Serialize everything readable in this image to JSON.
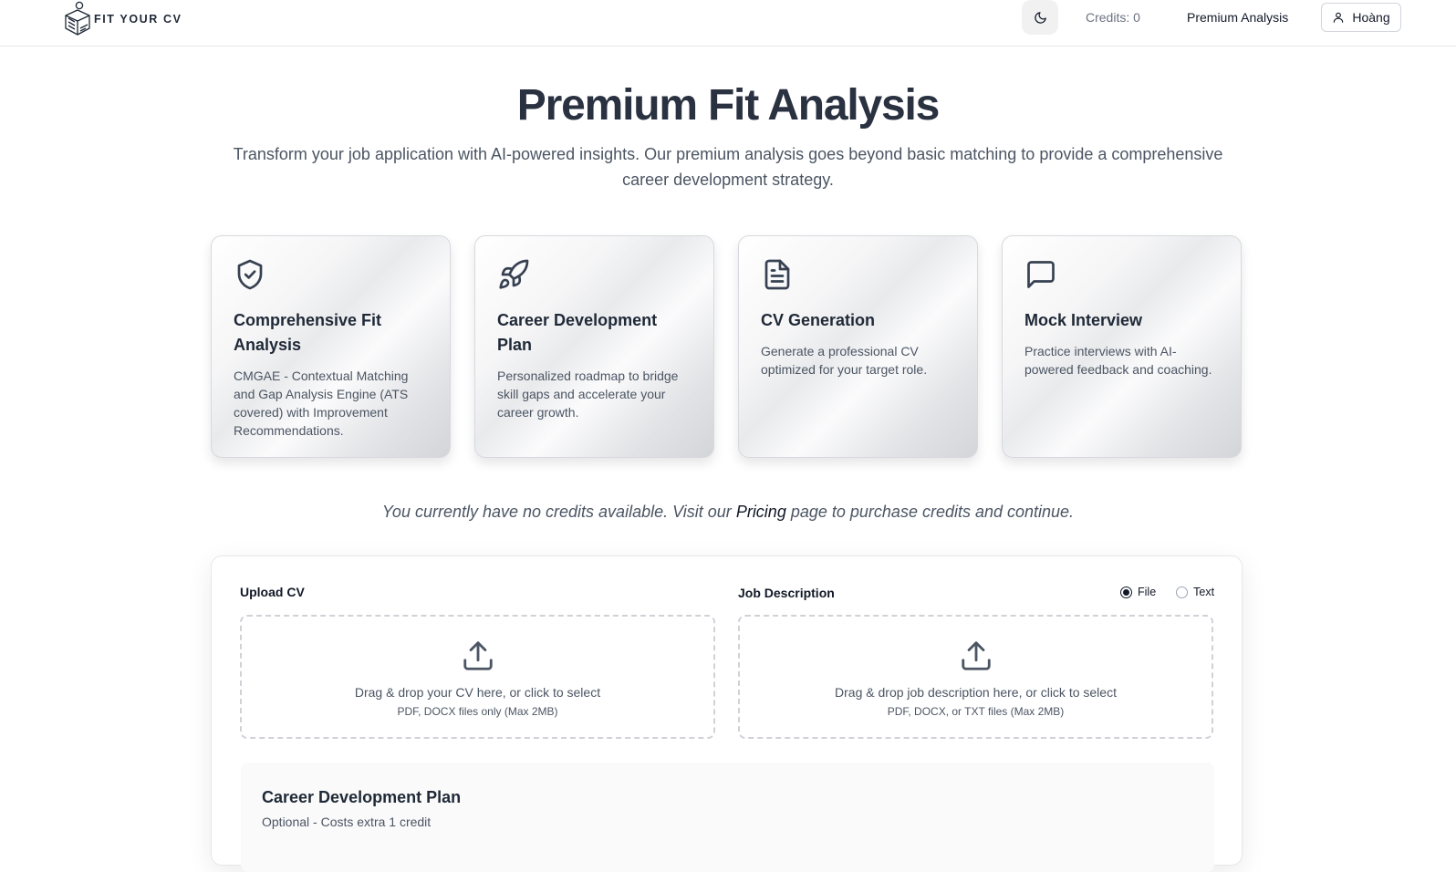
{
  "header": {
    "brand": "FIT YOUR CV",
    "credits_label": "Credits: 0",
    "nav_premium": "Premium Analysis",
    "user_name": "Hoàng",
    "icons": {
      "theme": "moon-icon",
      "user": "user-icon",
      "logo": "box-logo-icon"
    }
  },
  "hero": {
    "title": "Premium Fit Analysis",
    "subtitle": "Transform your job application with AI-powered insights. Our premium analysis goes beyond basic matching to provide a comprehensive career development strategy."
  },
  "features": [
    {
      "icon": "shield-check-icon",
      "title": "Comprehensive Fit Analysis",
      "description": "CMGAE - Contextual Matching and Gap Analysis Engine (ATS covered) with Improvement Recommendations."
    },
    {
      "icon": "rocket-icon",
      "title": "Career Development Plan",
      "description": "Personalized roadmap to bridge skill gaps and accelerate your career growth."
    },
    {
      "icon": "document-icon",
      "title": "CV Generation",
      "description": "Generate a professional CV optimized for your target role."
    },
    {
      "icon": "chat-bubble-icon",
      "title": "Mock Interview",
      "description": "Practice interviews with AI-powered feedback and coaching."
    }
  ],
  "notice": {
    "before": "You currently have no credits available. Visit our ",
    "link": "Pricing",
    "after": " page to purchase credits and continue."
  },
  "form": {
    "upload_cv_label": "Upload CV",
    "job_description_label": "Job Description",
    "jd_mode_options": [
      "File",
      "Text"
    ],
    "jd_mode_selected": "File",
    "cv_dropzone": {
      "main": "Drag & drop your CV here, or click to select",
      "sub": "PDF, DOCX files only (Max 2MB)"
    },
    "jd_dropzone": {
      "main": "Drag & drop job description here, or click to select",
      "sub": "PDF, DOCX, or TXT files (Max 2MB)"
    },
    "career_plan": {
      "title": "Career Development Plan",
      "subtitle": "Optional - Costs extra 1 credit"
    }
  },
  "colors": {
    "accent": "#111827",
    "title": "#2a3140",
    "muted": "#4b5563",
    "border": "#e5e7eb"
  }
}
